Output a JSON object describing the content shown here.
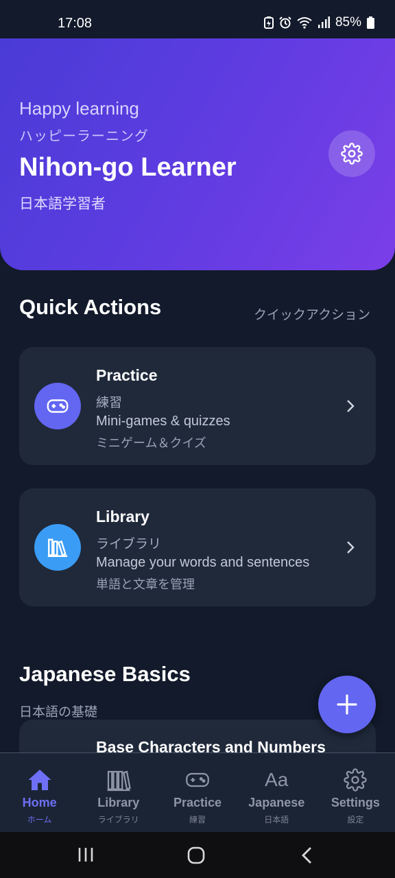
{
  "status_bar": {
    "time": "17:08",
    "battery": "85%"
  },
  "hero": {
    "greeting": "Happy learning",
    "greeting_jp": "ハッピーラーニング",
    "name": "Nihon-go Learner",
    "name_jp": "日本語学習者",
    "settings_icon": "gear-icon"
  },
  "quick_actions": {
    "title": "Quick Actions",
    "subtitle": "クイックアクション",
    "cards": [
      {
        "title": "Practice",
        "jp": "練習",
        "desc": "Mini-games & quizzes",
        "desc_jp": "ミニゲーム＆クイズ",
        "icon": "gamepad-icon",
        "icon_color": "#6366f1"
      },
      {
        "title": "Library",
        "jp": "ライブラリ",
        "desc": "Manage your words and sentences",
        "desc_jp": "単語と文章を管理",
        "icon": "library-icon",
        "icon_color": "#3b9cf5"
      }
    ]
  },
  "basics": {
    "title": "Japanese Basics",
    "subtitle": "日本語の基礎",
    "first_card_title": "Base Characters and Numbers"
  },
  "fab_icon": "plus-icon",
  "nav": {
    "items": [
      {
        "label": "Home",
        "sub": "ホーム",
        "icon": "home-icon",
        "active": true
      },
      {
        "label": "Library",
        "sub": "ライブラリ",
        "icon": "library-icon",
        "active": false
      },
      {
        "label": "Practice",
        "sub": "練習",
        "icon": "gamepad-icon",
        "active": false
      },
      {
        "label": "Japanese",
        "sub": "日本語",
        "icon": "font-icon",
        "active": false
      },
      {
        "label": "Settings",
        "sub": "設定",
        "icon": "gear-icon",
        "active": false
      }
    ]
  },
  "colors": {
    "accent": "#6366f1",
    "library_blue": "#3b9cf5",
    "background": "#121a2b",
    "card": "#1f293a"
  }
}
